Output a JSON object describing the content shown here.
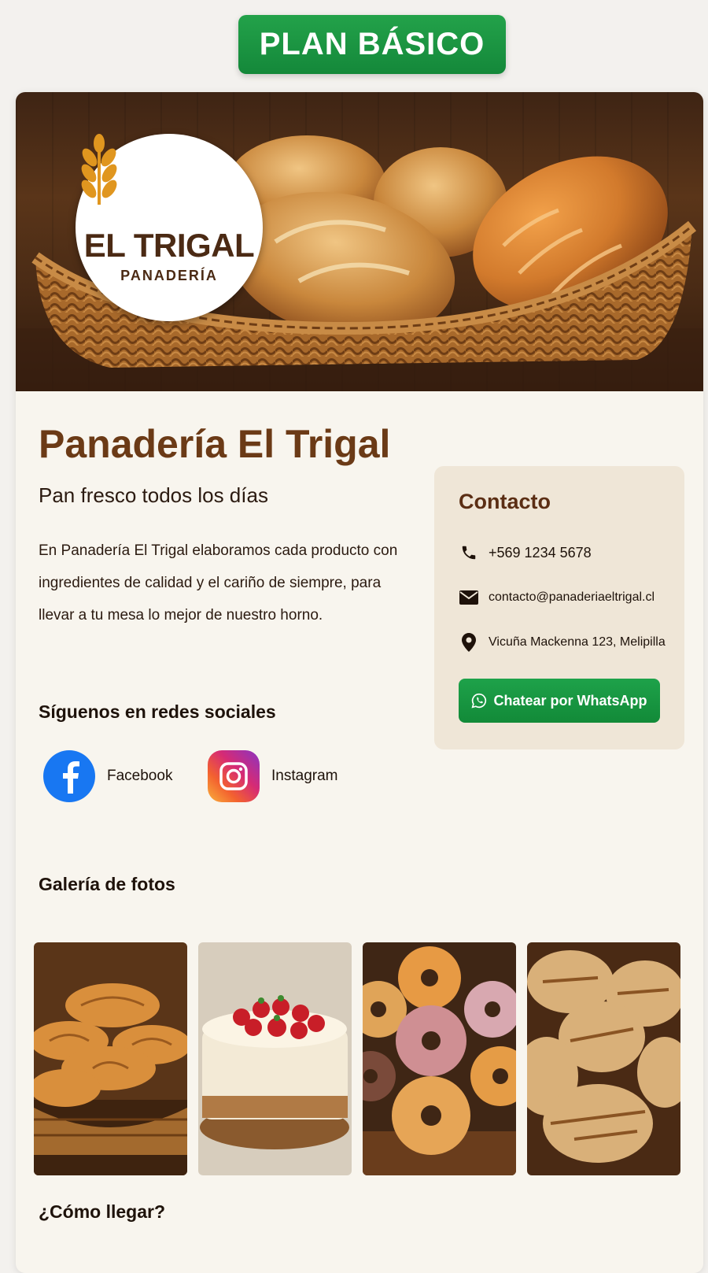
{
  "plan_badge": "PLAN BÁSICO",
  "logo": {
    "name": "EL TRIGAL",
    "subtitle": "PANADERÍA"
  },
  "business": {
    "name": "Panadería El Trigal",
    "tagline": "Pan fresco todos los días",
    "description": "En Panadería El Trigal elaboramos cada producto con ingredientes de calidad y el cariño de siempre, para llevar a tu mesa lo mejor de nuestro horno."
  },
  "contact": {
    "title": "Contacto",
    "phone": "+569 1234 5678",
    "email": "contacto@panaderiaeltrigal.cl",
    "address": "Vicuña Mackenna 123, Melipilla",
    "whatsapp_label": "Chatear por WhatsApp"
  },
  "social": {
    "title": "Síguenos en redes sociales",
    "items": [
      {
        "label": "Facebook",
        "icon": "facebook-icon"
      },
      {
        "label": "Instagram",
        "icon": "instagram-icon"
      }
    ]
  },
  "gallery": {
    "title": "Galería de fotos",
    "photos": [
      "croissants-photo",
      "strawberry-cake-photo",
      "donuts-photo",
      "artisan-bread-photo"
    ]
  },
  "directions": {
    "title": "¿Cómo llegar?"
  },
  "colors": {
    "badge_green": "#1a9641",
    "brand_brown": "#6b3a16",
    "whatsapp_green": "#1a9641",
    "facebook_blue": "#1877f2"
  }
}
